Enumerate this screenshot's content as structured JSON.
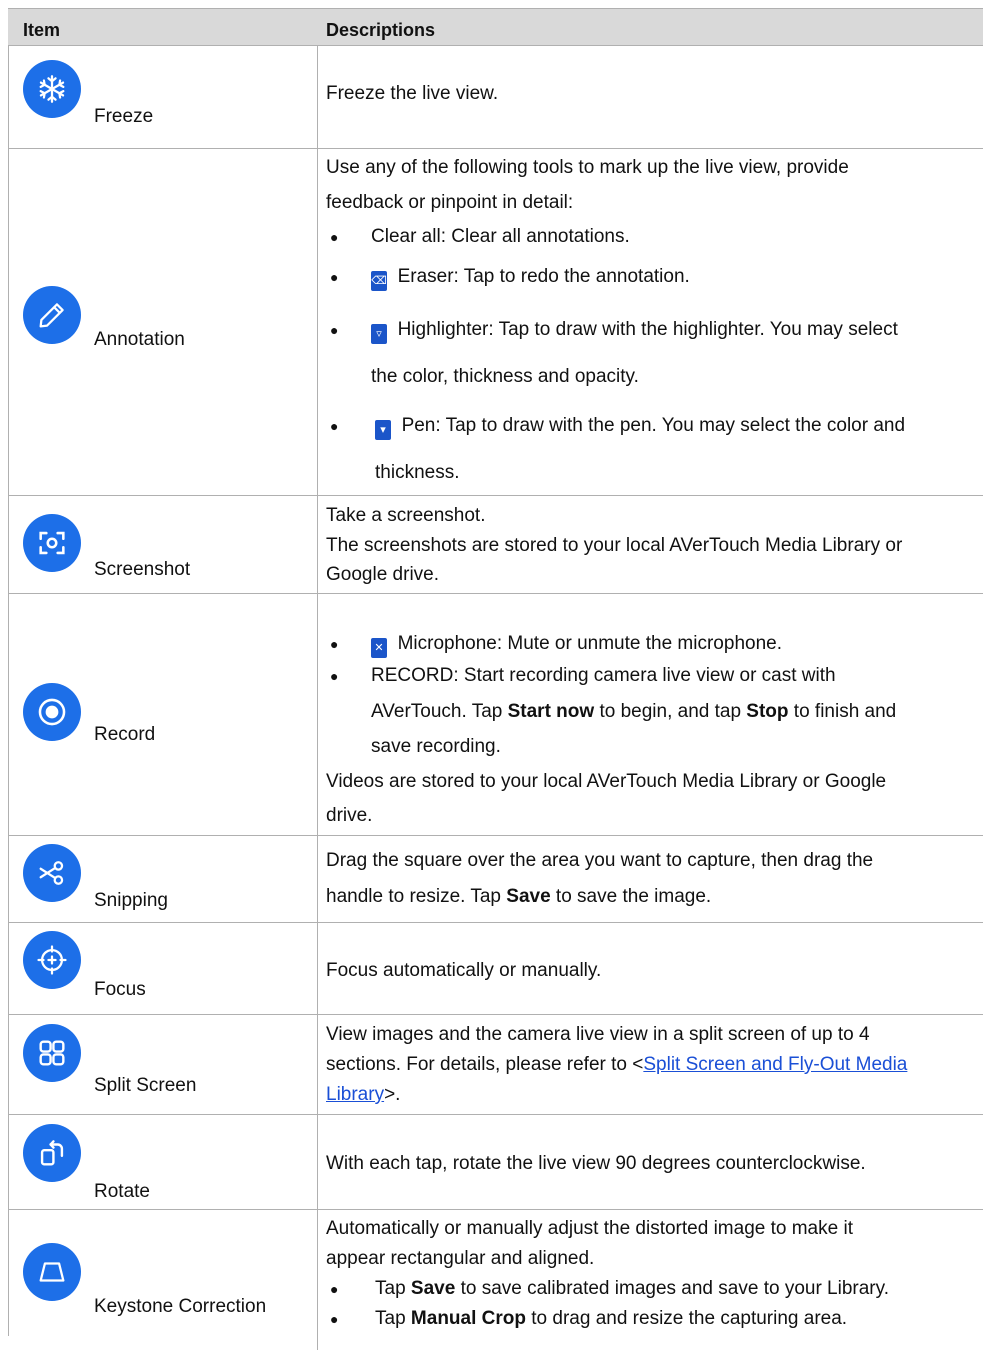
{
  "header": {
    "item": "Item",
    "descriptions": "Descriptions"
  },
  "accent_color": "#1d6fe8",
  "rows": {
    "freeze": {
      "label": "Freeze",
      "icon": "snowflake-icon",
      "desc": "Freeze the live view."
    },
    "annotation": {
      "label": "Annotation",
      "icon": "pencil-icon",
      "intro_1": "Use any of the following tools to mark up the live view, provide",
      "intro_2": "feedback or pinpoint in detail:",
      "b1": "Clear all: Clear all annotations.",
      "b2": "Eraser: Tap to redo the annotation.",
      "b3_1": "Highlighter: Tap to draw with the highlighter. You may select",
      "b3_2": "the color, thickness and opacity.",
      "b4_1": "Pen: Tap to draw with the pen. You may select the color and",
      "b4_2": "thickness."
    },
    "screenshot": {
      "label": "Screenshot",
      "icon": "screenshot-icon",
      "l1": "Take a screenshot.",
      "l2": "The screenshots are stored to your local AVerTouch Media Library or",
      "l3": "Google drive."
    },
    "record": {
      "label": "Record",
      "icon": "record-icon",
      "b1": "Microphone: Mute or unmute the microphone.",
      "b2_1": "RECORD: Start recording camera live view or cast with",
      "b2_2a": "AVerTouch. Tap ",
      "b2_2b": "Start now",
      "b2_2c": " to begin, and tap ",
      "b2_2d": "Stop",
      "b2_2e": " to finish and",
      "b2_3": "save recording.",
      "l1": "Videos are stored to your local AVerTouch Media Library or Google",
      "l2": "drive."
    },
    "snipping": {
      "label": "Snipping",
      "icon": "scissors-icon",
      "l1": "Drag the square over the area you want to capture, then drag the",
      "l2a": "handle to resize. Tap ",
      "l2b": "Save",
      "l2c": " to save the image."
    },
    "focus": {
      "label": "Focus",
      "icon": "crosshair-icon",
      "desc": "Focus automatically or manually."
    },
    "split": {
      "label": "Split Screen",
      "icon": "grid-icon",
      "l1": "View images and the camera live view in a split screen of up to 4",
      "l2a": "sections. For details, please refer to <",
      "link_a": "Split Screen and Fly-Out Media",
      "link_b": "Library",
      "l3b": ">."
    },
    "rotate": {
      "label": "Rotate",
      "icon": "rotate-icon",
      "desc": "With each tap, rotate the live view 90 degrees counterclockwise."
    },
    "keystone": {
      "label": "Keystone Correction",
      "icon": "keystone-icon",
      "l1": "Automatically or manually adjust the distorted image to make it",
      "l2": "appear rectangular and aligned.",
      "b1a": "Tap ",
      "b1b": "Save",
      "b1c": " to save calibrated images and save to your Library.",
      "b2a": "Tap ",
      "b2b": "Manual Crop",
      "b2c": " to drag and resize the capturing area."
    }
  }
}
